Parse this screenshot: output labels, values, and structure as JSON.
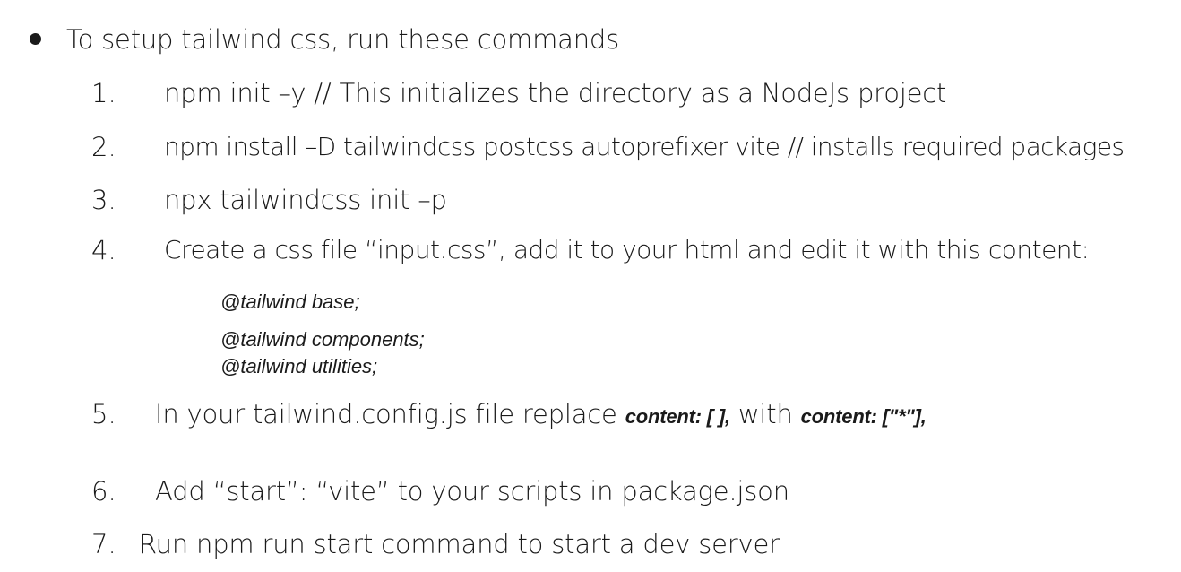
{
  "heading": "To setup tailwind css, run these commands",
  "steps": [
    {
      "num": "1.",
      "text": "npm init –y  // This initializes the directory as a NodeJs project"
    },
    {
      "num": "2.",
      "text": "npm install –D tailwindcss postcss autoprefixer vite // installs required packages"
    },
    {
      "num": "3.",
      "text": "npx tailwindcss init –p"
    },
    {
      "num": "4.",
      "text": "Create a css file “input.css”, add it to your html and edit it with this content:"
    },
    {
      "num": "5.",
      "text_before": "In your tailwind.config.js file replace ",
      "code1": "content: [ ],",
      "text_mid": " with ",
      "code2": "content: [\"*\"],"
    },
    {
      "num": "6.",
      "text": "Add “start”: “vite” to your scripts in package.json"
    },
    {
      "num": "7.",
      "text": "Run npm run start command to start a dev server"
    }
  ],
  "css_lines": [
    "@tailwind base;",
    "@tailwind components;",
    "@tailwind utilities;"
  ]
}
